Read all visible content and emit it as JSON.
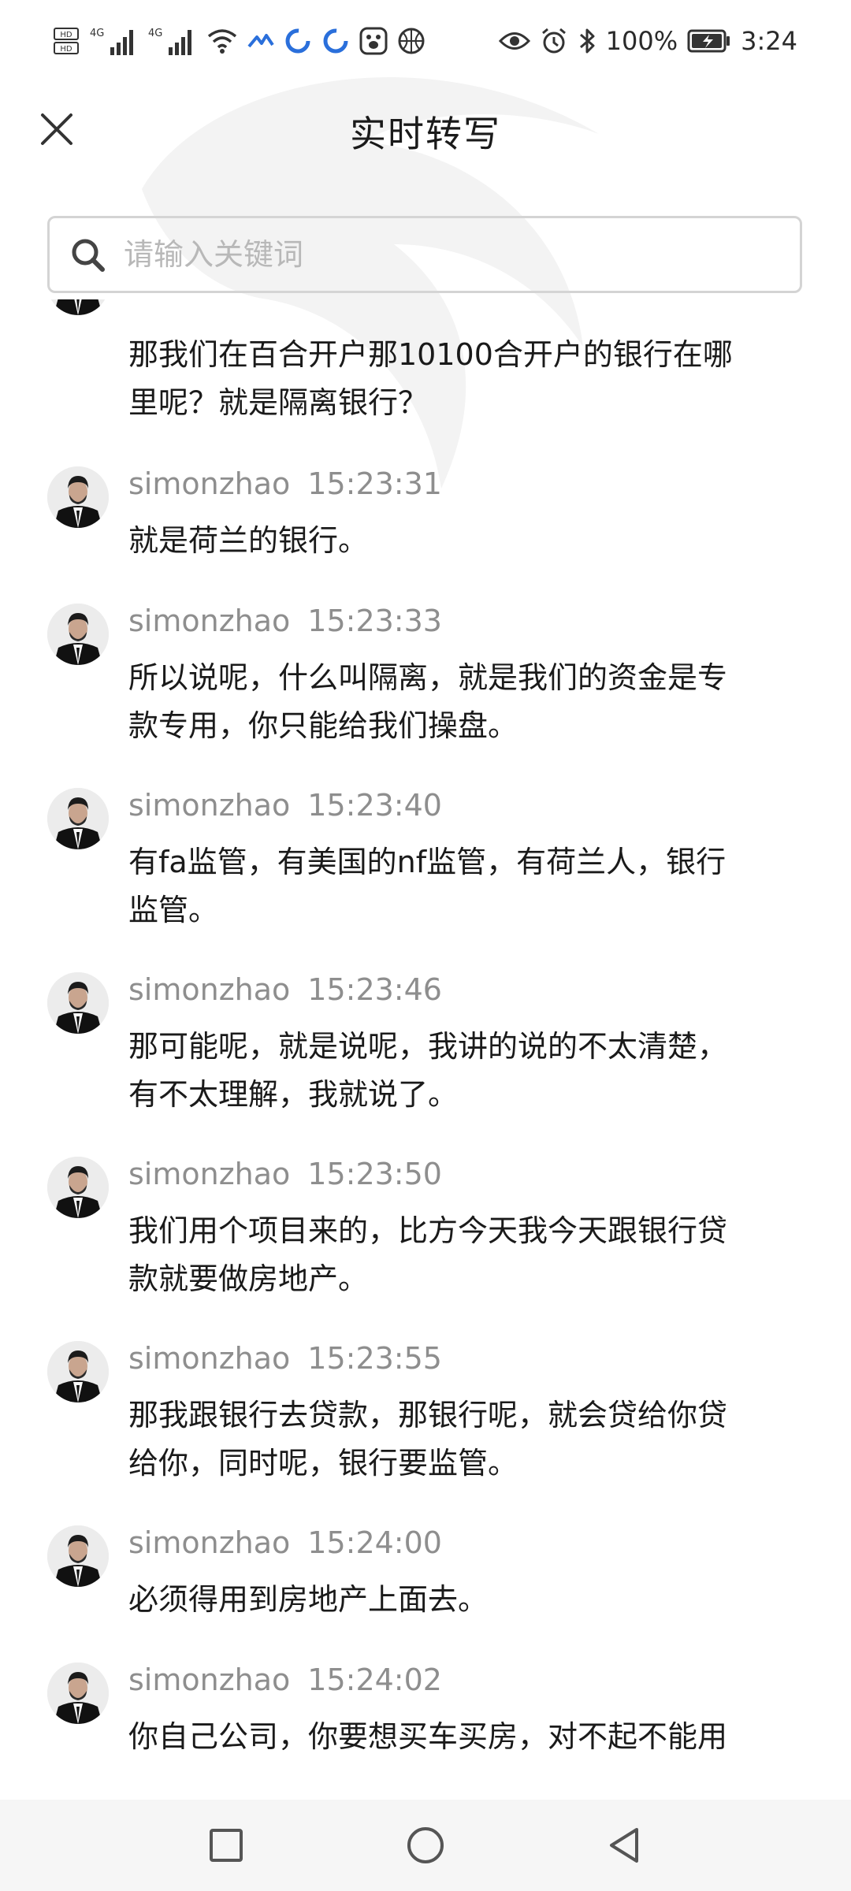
{
  "status_bar": {
    "network_1": "4G",
    "network_2": "4G",
    "battery": "100%",
    "time": "3:24"
  },
  "header": {
    "title": "实时转写",
    "close_icon": "close-icon"
  },
  "search": {
    "placeholder": "请输入关键词",
    "value": ""
  },
  "transcript": [
    {
      "speaker": "",
      "time": "",
      "text_lines": [
        "那我们在百合开户那10100合开户的银行在哪",
        "里呢？就是隔离银行？"
      ]
    },
    {
      "speaker": "simonzhao",
      "time": "15:23:31",
      "text_lines": [
        "就是荷兰的银行。"
      ]
    },
    {
      "speaker": "simonzhao",
      "time": "15:23:33",
      "text_lines": [
        "所以说呢，什么叫隔离，就是我们的资金是专",
        "款专用，你只能给我们操盘。"
      ]
    },
    {
      "speaker": "simonzhao",
      "time": "15:23:40",
      "text_lines": [
        "有fa监管，有美国的nf监管，有荷兰人，银行",
        "监管。"
      ]
    },
    {
      "speaker": "simonzhao",
      "time": "15:23:46",
      "text_lines": [
        "那可能呢，就是说呢，我讲的说的不太清楚，",
        "有不太理解，我就说了。"
      ]
    },
    {
      "speaker": "simonzhao",
      "time": "15:23:50",
      "text_lines": [
        "我们用个项目来的，比方今天我今天跟银行贷",
        "款就要做房地产。"
      ]
    },
    {
      "speaker": "simonzhao",
      "time": "15:23:55",
      "text_lines": [
        "那我跟银行去贷款，那银行呢，就会贷给你贷",
        "给你，同时呢，银行要监管。"
      ]
    },
    {
      "speaker": "simonzhao",
      "time": "15:24:00",
      "text_lines": [
        "必须得用到房地产上面去。"
      ]
    },
    {
      "speaker": "simonzhao",
      "time": "15:24:02",
      "text_lines": [
        "你自己公司，你要想买车买房，对不起不能用"
      ]
    }
  ],
  "nav_bar": {
    "recents_icon": "square-icon",
    "home_icon": "circle-icon",
    "back_icon": "triangle-back-icon"
  },
  "colors": {
    "text_primary": "#1a1a1a",
    "text_secondary": "#8e8e8e",
    "placeholder": "#b8b8b8",
    "border": "#d4d4d4",
    "nav_bg": "#f6f6f6"
  }
}
